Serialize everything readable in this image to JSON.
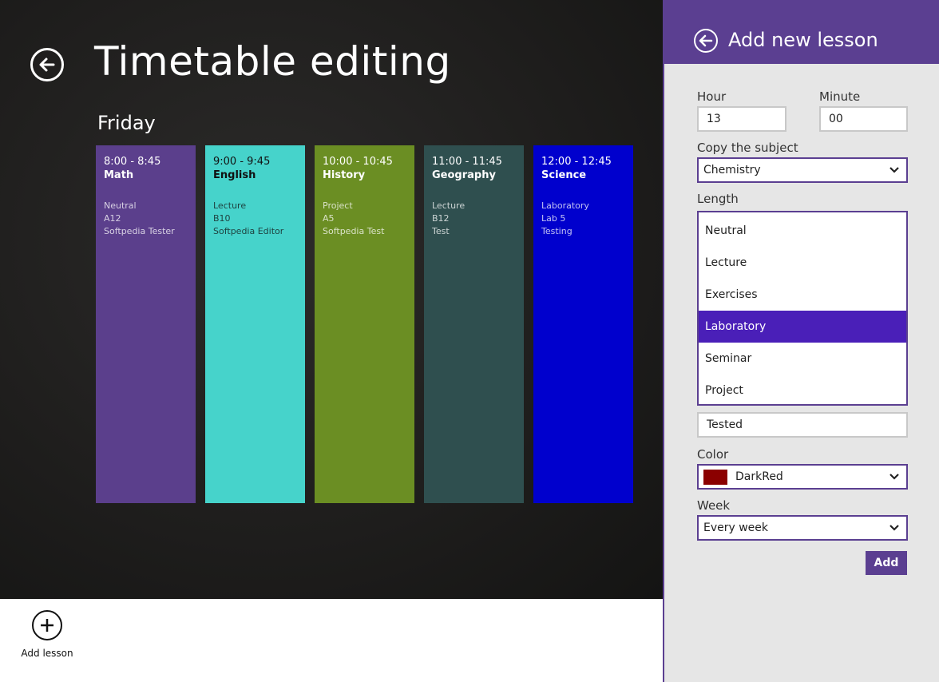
{
  "page": {
    "title": "Timetable editing",
    "day": "Friday"
  },
  "lessons": [
    {
      "time": "8:00 - 8:45",
      "subject": "Math",
      "type": "Neutral",
      "room": "A12",
      "teacher": "Softpedia Tester",
      "color": "#5b3f8c",
      "text_color": "#ffffff"
    },
    {
      "time": "9:00 - 9:45",
      "subject": "English",
      "type": "Lecture",
      "room": "B10",
      "teacher": "Softpedia Editor",
      "color": "#46d3cb",
      "text_color": "#111111"
    },
    {
      "time": "10:00 - 10:45",
      "subject": "History",
      "type": "Project",
      "room": "A5",
      "teacher": "Softpedia Test",
      "color": "#6b8e23",
      "text_color": "#ffffff"
    },
    {
      "time": "11:00 - 11:45",
      "subject": "Geography",
      "type": "Lecture",
      "room": "B12",
      "teacher": "Test",
      "color": "#2f4f4f",
      "text_color": "#ffffff"
    },
    {
      "time": "12:00 - 12:45",
      "subject": "Science",
      "type": "Laboratory",
      "room": "Lab 5",
      "teacher": "Testing",
      "color": "#0000cd",
      "text_color": "#ffffff"
    }
  ],
  "appbar": {
    "add_lesson_label": "Add lesson",
    "add_icon": "plus-circle-icon"
  },
  "flyout": {
    "title": "Add new lesson",
    "back_icon": "back-arrow-icon",
    "accent_color": "#5b3f91",
    "hour_label": "Hour",
    "hour_value": "13",
    "minute_label": "Minute",
    "minute_value": "00",
    "copy_subject_label": "Copy the subject",
    "copy_subject_value": "Chemistry",
    "length_label": "Length",
    "teacher_value": "Tested",
    "color_label": "Color",
    "color_value": "DarkRed",
    "color_swatch": "#8b0000",
    "week_label": "Week",
    "week_value": "Every week",
    "add_button": "Add"
  },
  "dropdown": {
    "items": [
      "Neutral",
      "Lecture",
      "Exercises",
      "Laboratory",
      "Seminar",
      "Project"
    ],
    "selected": "Laboratory",
    "selected_color": "#4a1fb8"
  }
}
